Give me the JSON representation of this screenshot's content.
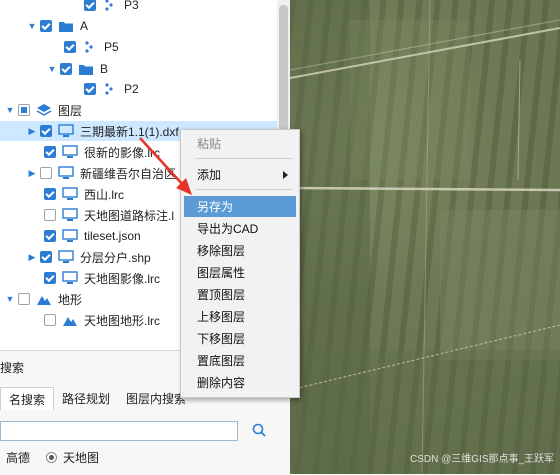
{
  "tree": {
    "p3_label": "P3",
    "group_a_label": "A",
    "p5_label": "P5",
    "group_b_label": "B",
    "p2_label": "P2",
    "layers_label": "图层",
    "layer_1": "三期最新1.1(1).dxf",
    "layer_2": "很新的影像.lrc",
    "layer_3": "新疆维吾尔自治区",
    "layer_4": "西山.lrc",
    "layer_5": "天地图道路标注.l",
    "layer_6": "tileset.json",
    "layer_7": "分层分户.shp",
    "layer_8": "天地图影像.lrc",
    "terrain_label": "地形",
    "terrain_1": "天地图地形.lrc"
  },
  "search": {
    "title": "搜索",
    "tabs": [
      "名搜索",
      "路径规划",
      "图层内搜索"
    ],
    "placeholder": "",
    "radio_1": "高德",
    "radio_2": "天地图"
  },
  "context_menu": {
    "paste": "粘贴",
    "add": "添加",
    "save_as": "另存为",
    "export_cad": "导出为CAD",
    "remove_layer": "移除图层",
    "layer_props": "图层属性",
    "top_layer": "置顶图层",
    "move_up": "上移图层",
    "move_down": "下移图层",
    "bottom_layer": "置底图层",
    "delete_content": "删除内容"
  },
  "watermark": "CSDN @三维GIS那点事_王跃军",
  "colors": {
    "accent": "#2b7cd3",
    "menu_highlight": "#5b9bd5",
    "selection": "#cde8ff",
    "arrow": "#e5332a"
  }
}
